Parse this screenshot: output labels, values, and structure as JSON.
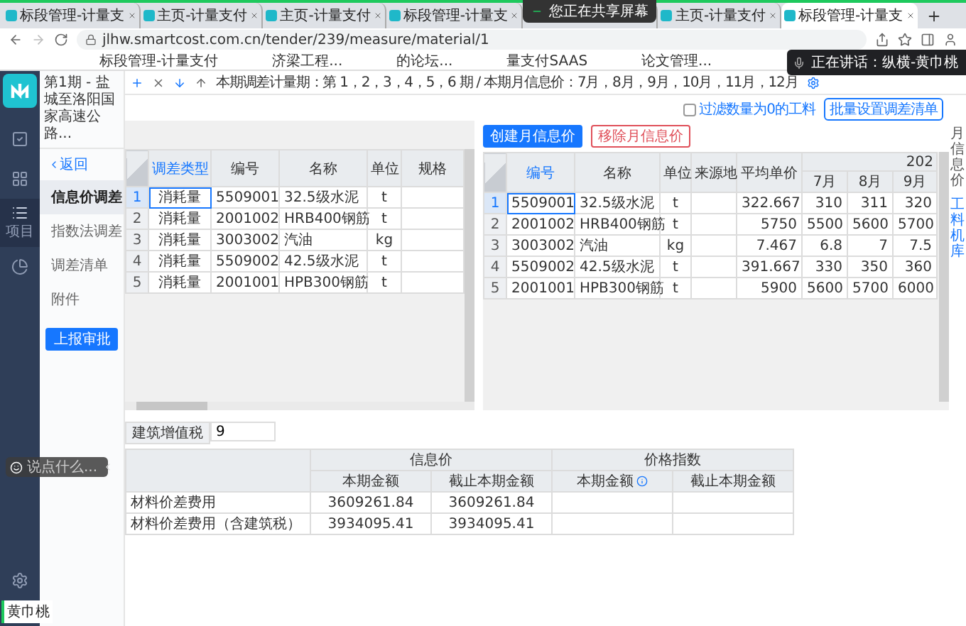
{
  "browser": {
    "tabs": [
      {
        "title": "标段管理-计量支",
        "selected": false
      },
      {
        "title": "主页-计量支付",
        "selected": false
      },
      {
        "title": "主页-计量支付",
        "selected": false
      },
      {
        "title": "标段管理-计量支",
        "selected": false
      },
      {
        "title": "主页-计量支付",
        "selected": false
      },
      {
        "title": "标段管理-计量支",
        "selected": true
      }
    ],
    "share_banner": "您正在共享屏幕",
    "url": "jlhw.smartcost.com.cn/tender/239/measure/material/1",
    "bookmarks": [
      "标段管理-计量支付",
      "济梁工程...",
      "的论坛...",
      "量支付SAAS",
      "论文管理..."
    ],
    "speaking": "正在讲话：纵横-黄巾桃"
  },
  "nav": {
    "items": [
      {
        "kind": "check",
        "selected": false
      },
      {
        "kind": "grid",
        "selected": false
      },
      {
        "kind": "list",
        "label": "项目",
        "selected": true
      },
      {
        "kind": "pie",
        "selected": false
      }
    ],
    "user": "黄巾桃"
  },
  "sidebar": {
    "title": "第1期 - 盐城至洛阳国家高速公路...",
    "back": "返回",
    "items": [
      {
        "label": "信息价调差",
        "selected": true
      },
      {
        "label": "指数法调差",
        "selected": false
      },
      {
        "label": "调差清单",
        "selected": false
      },
      {
        "label": "附件",
        "selected": false
      }
    ],
    "submit": "上报审批"
  },
  "toolbar": {
    "info": "本期调差计量期：第 1，2，3，4，5，6 期 / 本期月信息价：7月，8月，9月，10月，11月，12月",
    "filter": {
      "label": "过滤数量为0的工料",
      "checked": false
    },
    "batch_button": "批量设置调差清单"
  },
  "left_table": {
    "columns": [
      {
        "label": "调差类型",
        "selected": true
      },
      {
        "label": "编号",
        "selected": false
      },
      {
        "label": "名称",
        "selected": false
      },
      {
        "label": "单位",
        "selected": false
      },
      {
        "label": "规格",
        "selected": false
      }
    ],
    "rows": [
      {
        "num": "1",
        "selected": true,
        "cells": [
          "消耗量",
          "5509001",
          "32.5级水泥",
          "t",
          ""
        ]
      },
      {
        "num": "2",
        "selected": false,
        "cells": [
          "消耗量",
          "2001002",
          "HRB400钢筋",
          "t",
          ""
        ]
      },
      {
        "num": "3",
        "selected": false,
        "cells": [
          "消耗量",
          "3003002",
          "汽油",
          "kg",
          ""
        ]
      },
      {
        "num": "4",
        "selected": false,
        "cells": [
          "消耗量",
          "5509002",
          "42.5级水泥",
          "t",
          ""
        ]
      },
      {
        "num": "5",
        "selected": false,
        "cells": [
          "消耗量",
          "2001001",
          "HPB300钢筋",
          "t",
          ""
        ]
      }
    ]
  },
  "right_panel": {
    "create_button": "创建月信息价",
    "remove_button": "移除月信息价",
    "columns": [
      {
        "label": "编号",
        "selected": true
      },
      {
        "label": "名称",
        "selected": false
      },
      {
        "label": "单位",
        "selected": false
      },
      {
        "label": "来源地",
        "selected": false
      },
      {
        "label": "平均单价",
        "selected": false
      }
    ],
    "group_label": "202",
    "months": [
      "7月",
      "8月",
      "9月"
    ],
    "rows": [
      {
        "num": "1",
        "selected": true,
        "cells": [
          "5509001",
          "32.5级水泥",
          "t",
          "",
          "322.667",
          "310",
          "311",
          "320"
        ]
      },
      {
        "num": "2",
        "selected": false,
        "cells": [
          "2001002",
          "HRB400钢筋",
          "t",
          "",
          "5750",
          "5500",
          "5600",
          "5700"
        ]
      },
      {
        "num": "3",
        "selected": false,
        "cells": [
          "3003002",
          "汽油",
          "kg",
          "",
          "7.467",
          "6.8",
          "7",
          "7.5"
        ]
      },
      {
        "num": "4",
        "selected": false,
        "cells": [
          "5509002",
          "42.5级水泥",
          "t",
          "",
          "391.667",
          "330",
          "350",
          "360"
        ]
      },
      {
        "num": "5",
        "selected": false,
        "cells": [
          "2001001",
          "HPB300钢筋",
          "t",
          "",
          "5900",
          "5600",
          "5700",
          "6000"
        ]
      }
    ]
  },
  "right_strip": [
    "月信息价",
    "工料机库"
  ],
  "tax": {
    "label": "建筑增值税",
    "value": "9"
  },
  "summary": {
    "groups": [
      "信息价",
      "价格指数"
    ],
    "subcolumns": [
      "本期金额",
      "截止本期金额",
      "本期金额",
      "截止本期金额"
    ],
    "rows": [
      {
        "label": "材料价差费用",
        "cells": [
          "3609261.84",
          "3609261.84",
          "",
          ""
        ]
      },
      {
        "label": "材料价差费用（含建筑税）",
        "cells": [
          "3934095.41",
          "3934095.41",
          "",
          ""
        ]
      }
    ]
  },
  "chat": {
    "placeholder": "说点什么..."
  }
}
